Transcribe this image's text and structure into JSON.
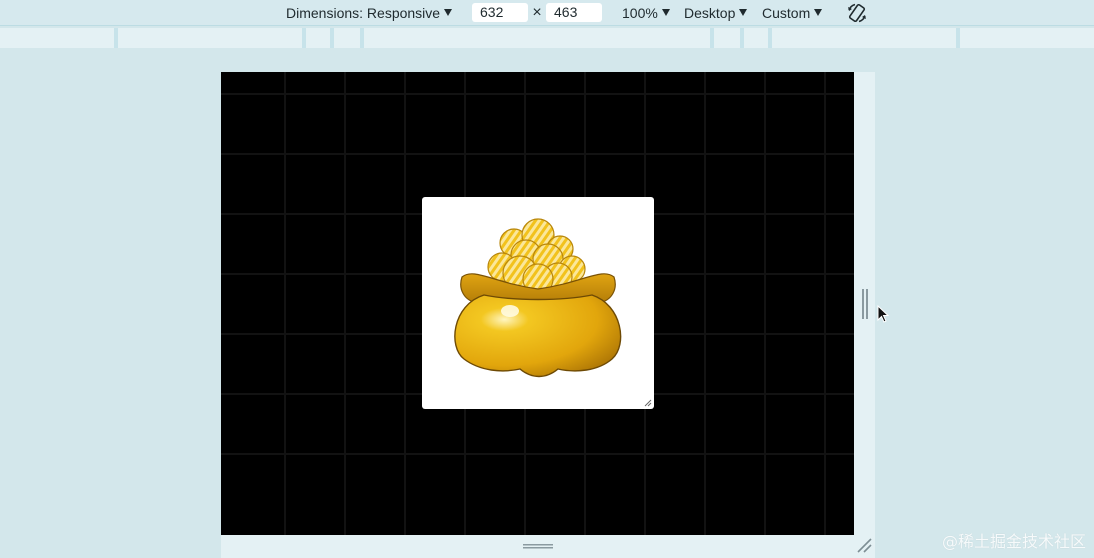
{
  "toolbar": {
    "dimensions_label": "Dimensions: Responsive",
    "width_value": "632",
    "times_symbol": "×",
    "height_value": "463",
    "zoom_label": "100%",
    "device_type_label": "Desktop",
    "throttle_label": "Custom",
    "rotate_icon": "rotate-icon"
  },
  "viewport": {
    "background_color": "#000000",
    "card_color": "#ffffff",
    "illustration": "pot-of-gold-coins"
  },
  "watermark": {
    "text": "@稀土掘金技术社区"
  },
  "colors": {
    "toolbar_bg": "#d6e9ee",
    "page_bg": "#d3e7eb",
    "mq_bar": "#c7e3ea",
    "gold": "#e8b20e"
  }
}
